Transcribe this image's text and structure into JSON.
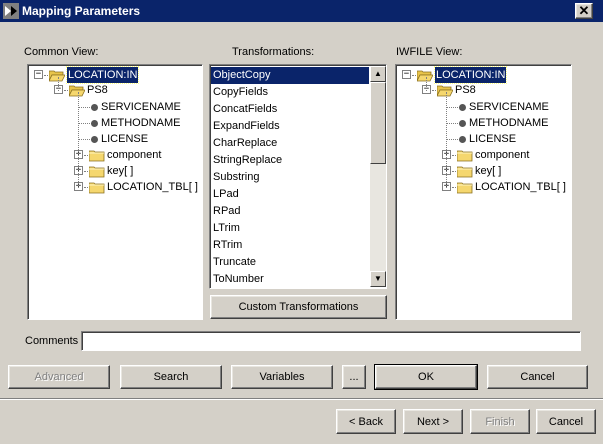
{
  "window": {
    "title": "Mapping Parameters",
    "close_label": "✕"
  },
  "labels": {
    "common_view": "Common View:",
    "transformations": "Transformations:",
    "iwfile_view": "IWFILE View:",
    "comments": "Comments"
  },
  "common_tree": [
    {
      "label": "LOCATION:IN",
      "icon": "folder-open-icon",
      "expander": "−",
      "selected": true
    },
    {
      "label": "PS8",
      "icon": "folder-open-icon",
      "expander": "−"
    },
    {
      "label": "SERVICENAME",
      "icon": "bullet-icon"
    },
    {
      "label": "METHODNAME",
      "icon": "bullet-icon"
    },
    {
      "label": "LICENSE",
      "icon": "bullet-icon"
    },
    {
      "label": "component",
      "icon": "folder-icon",
      "expander": "+"
    },
    {
      "label": "key[ ]",
      "icon": "folder-icon",
      "expander": "+"
    },
    {
      "label": "LOCATION_TBL[ ]",
      "icon": "folder-icon",
      "expander": "+"
    }
  ],
  "iwfile_tree": [
    {
      "label": "LOCATION:IN",
      "icon": "folder-open-icon",
      "expander": "−",
      "selected": true
    },
    {
      "label": "PS8",
      "icon": "folder-open-icon",
      "expander": "−"
    },
    {
      "label": "SERVICENAME",
      "icon": "bullet-icon"
    },
    {
      "label": "METHODNAME",
      "icon": "bullet-icon"
    },
    {
      "label": "LICENSE",
      "icon": "bullet-icon"
    },
    {
      "label": "component",
      "icon": "folder-icon",
      "expander": "+"
    },
    {
      "label": "key[ ]",
      "icon": "folder-icon",
      "expander": "+"
    },
    {
      "label": "LOCATION_TBL[ ]",
      "icon": "folder-icon",
      "expander": "+"
    }
  ],
  "transformations": {
    "items": [
      "ObjectCopy",
      "CopyFields",
      "ConcatFields",
      "ExpandFields",
      "CharReplace",
      "StringReplace",
      "Substring",
      "LPad",
      "RPad",
      "LTrim",
      "RTrim",
      "Truncate",
      "ToNumber"
    ],
    "selected": "ObjectCopy",
    "custom_button": "Custom Transformations"
  },
  "comments": {
    "value": ""
  },
  "action_buttons": {
    "advanced": "Advanced",
    "search": "Search",
    "variables": "Variables",
    "ellipsis": "...",
    "ok": "OK",
    "cancel": "Cancel"
  },
  "wizard_buttons": {
    "back": "< Back",
    "next": "Next >",
    "finish": "Finish",
    "cancel": "Cancel"
  },
  "colors": {
    "titlebar": "#0a246a",
    "face": "#d4d0c8",
    "selection": "#0a246a",
    "folder": "#f5d76e"
  }
}
